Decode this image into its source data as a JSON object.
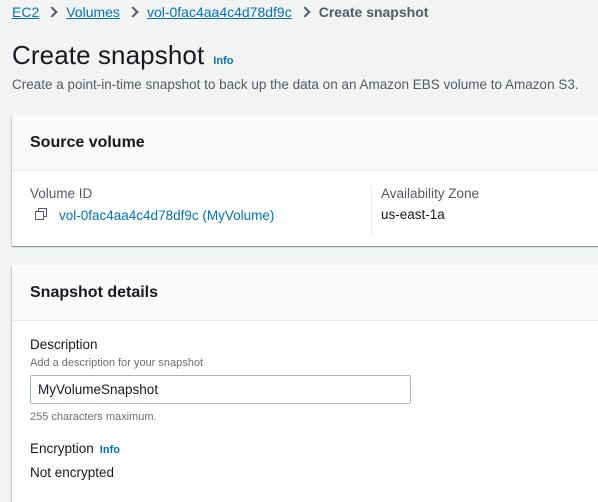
{
  "breadcrumb": {
    "items": [
      "EC2",
      "Volumes",
      "vol-0fac4aa4c4d78df9c"
    ],
    "current": "Create snapshot"
  },
  "header": {
    "title": "Create snapshot",
    "info": "Info",
    "description": "Create a point-in-time snapshot to back up the data on an Amazon EBS volume to Amazon S3."
  },
  "source_volume": {
    "title": "Source volume",
    "volume_id_label": "Volume ID",
    "volume_id_value": "vol-0fac4aa4c4d78df9c (MyVolume)",
    "az_label": "Availability Zone",
    "az_value": "us-east-1a"
  },
  "snapshot_details": {
    "title": "Snapshot details",
    "description_label": "Description",
    "description_hint": "Add a description for your snapshot",
    "description_value": "MyVolumeSnapshot",
    "description_constraint": "255 characters maximum.",
    "encryption_label": "Encryption",
    "encryption_info": "Info",
    "encryption_value": "Not encrypted"
  },
  "icons": {
    "volume_link": "copy-icon",
    "breadcrumb_separator": "chevron-right-icon"
  },
  "colors": {
    "link": "#0073bb",
    "background": "#f2f3f3",
    "text": "#16191f",
    "secondary_text": "#545b64"
  }
}
